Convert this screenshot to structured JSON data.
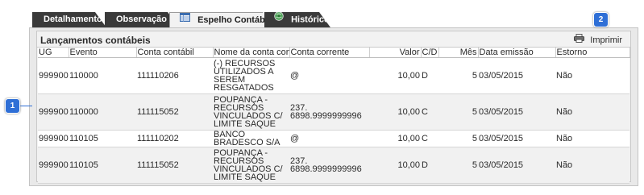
{
  "tabs": [
    {
      "label": "Detalhamento"
    },
    {
      "label": "Observação"
    },
    {
      "label": "Espelho Contábil",
      "active": true
    },
    {
      "label": "Histórico"
    }
  ],
  "panel": {
    "title": "Lançamentos contábeis",
    "print_label": "Imprimir"
  },
  "table": {
    "columns": [
      "UG",
      "Evento",
      "Conta contábil",
      "Nome da conta contábil",
      "Conta corrente",
      "Valor",
      "C/D",
      "Mês",
      "Data emissão",
      "Estorno"
    ],
    "rows": [
      {
        "ug": "999900",
        "evento": "110000",
        "conta": "111110206",
        "nome": "(-) RECURSOS UTILIZADOS A SEREM RESGATADOS",
        "corrente": "@",
        "valor": "10,00",
        "cd": "D",
        "mes": "5",
        "data": "03/05/2015",
        "estorno": "Não"
      },
      {
        "ug": "999900",
        "evento": "110000",
        "conta": "111115052",
        "nome": "POUPANÇA - RECURSOS VINCULADOS C/ LIMITE SAQUE",
        "corrente": "237. 6898.9999999996",
        "valor": "10,00",
        "cd": "C",
        "mes": "5",
        "data": "03/05/2015",
        "estorno": "Não"
      },
      {
        "ug": "999900",
        "evento": "110105",
        "conta": "111110202",
        "nome": "BANCO BRADESCO S/A",
        "corrente": "@",
        "valor": "10,00",
        "cd": "C",
        "mes": "5",
        "data": "03/05/2015",
        "estorno": "Não"
      },
      {
        "ug": "999900",
        "evento": "110105",
        "conta": "111115052",
        "nome": "POUPANÇA - RECURSOS VINCULADOS C/ LIMITE SAQUE",
        "corrente": "237. 6898.9999999996",
        "valor": "10,00",
        "cd": "D",
        "mes": "5",
        "data": "03/05/2015",
        "estorno": "Não"
      }
    ]
  },
  "callouts": [
    {
      "label": "1"
    },
    {
      "label": "2"
    }
  ],
  "icons": {
    "tab_espelho": "ledger-icon",
    "tab_historico": "history-globe-icon",
    "print": "printer-icon"
  },
  "colors": {
    "tab_dark": "#3a3a3a",
    "callout": "#2f6fd6"
  }
}
